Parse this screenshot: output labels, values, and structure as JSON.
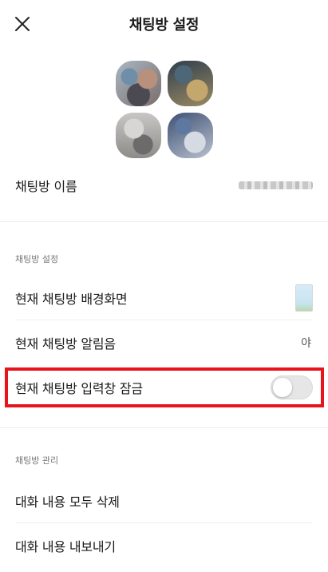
{
  "header": {
    "title": "채팅방 설정",
    "close_icon": "close-icon"
  },
  "chat_name": {
    "label": "채팅방 이름"
  },
  "sections": {
    "settings_title": "채팅방 설정",
    "management_title": "채팅방 관리"
  },
  "settings": {
    "background_label": "현재 채팅방 배경화면",
    "notification_label": "현재 채팅방 알림음",
    "notification_value": "야",
    "input_lock_label": "현재 채팅방 입력창 잠금",
    "input_lock_on": false
  },
  "management": {
    "delete_all_label": "대화 내용 모두 삭제",
    "export_label": "대화 내용 내보내기"
  },
  "colors": {
    "highlight": "#e8141b",
    "toggle_off": "#e6e6e6"
  }
}
